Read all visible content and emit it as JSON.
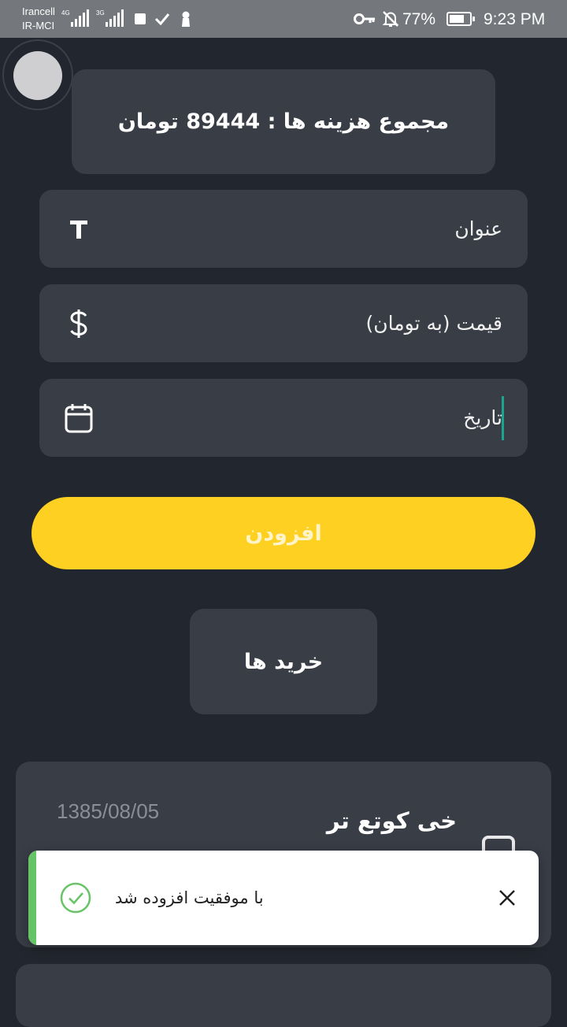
{
  "status_bar": {
    "carrier_1": "Irancell",
    "carrier_2": "IR-MCI",
    "network_1": "4G",
    "network_2": "3G",
    "battery_percent": "77%",
    "battery_level": 0.77,
    "time": "9:23 PM",
    "icons": [
      "signal-icon",
      "stop-icon",
      "check-icon",
      "keyhole-icon",
      "key-icon",
      "bell-off-icon",
      "battery-icon"
    ]
  },
  "avatar": {
    "icon": "avatar-placeholder"
  },
  "summary": {
    "total_text": "مجموع هزینه ها : 89444 تومان"
  },
  "form": {
    "title": {
      "label": "عنوان",
      "icon": "text-T-icon"
    },
    "price": {
      "label": "قیمت (به تومان)",
      "icon": "dollar-icon"
    },
    "date": {
      "label": "تاریخ",
      "icon": "calendar-icon"
    },
    "submit_label": "افزودن"
  },
  "purchases_button": {
    "label": "خرید ها"
  },
  "purchases": [
    {
      "title": "خی کوتع تر",
      "date": "1385/08/05",
      "icon": "box-icon"
    },
    {
      "title": "",
      "date": "",
      "icon": "box-icon"
    }
  ],
  "toast": {
    "message": "با موفقیت افزوده شد",
    "icon": "success-check-icon",
    "close_icon": "close-icon",
    "accent": "#65c466"
  },
  "colors": {
    "background": "#22262e",
    "card": "#393d46",
    "accent_yellow": "#fdd021",
    "caret": "#19a58e"
  }
}
